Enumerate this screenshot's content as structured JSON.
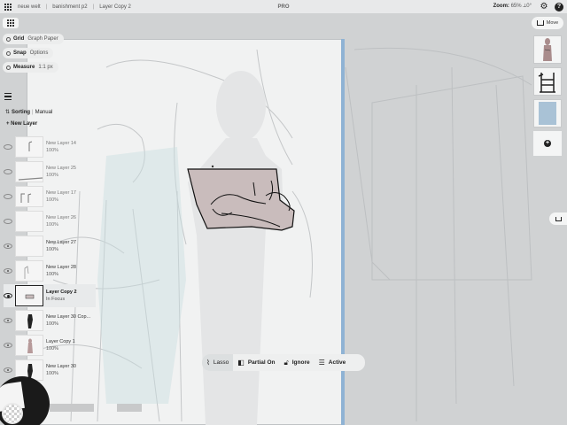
{
  "topbar": {
    "breadcrumbs": [
      "neue welt",
      "banishment p2",
      "Layer Copy 2"
    ],
    "title": "PRO",
    "zoom_label": "Zoom:",
    "zoom_value": "65% ⟂0°"
  },
  "tool_options": [
    {
      "label": "Grid",
      "value": "Graph Paper"
    },
    {
      "label": "Snap",
      "value": "Options"
    },
    {
      "label": "Measure",
      "value": "1:1 px"
    }
  ],
  "layers_panel": {
    "sorting_label": "Sorting",
    "sorting_value": "Manual",
    "new_layer_label": "+ New Layer",
    "layers": [
      {
        "name": "New Layer 14",
        "opacity": "100%"
      },
      {
        "name": "New Layer 25",
        "opacity": "100%"
      },
      {
        "name": "New Layer 17",
        "opacity": "100%"
      },
      {
        "name": "New Layer 26",
        "opacity": "100%"
      },
      {
        "name": "New Layer 27",
        "opacity": "100%"
      },
      {
        "name": "New Layer 28",
        "opacity": "100%"
      },
      {
        "name": "Layer Copy 2",
        "opacity": "In Focus"
      },
      {
        "name": "New Layer 30 Cop...",
        "opacity": "100%"
      },
      {
        "name": "Layer Copy 1",
        "opacity": "100%"
      },
      {
        "name": "New Layer 30",
        "opacity": "100%"
      }
    ]
  },
  "right_panel": {
    "move_label": "Move"
  },
  "selection_toolbar": {
    "lasso": "Lasso",
    "partial": "Partial On",
    "ignore": "Ignore",
    "active": "Active"
  },
  "colors": {
    "artwork_fill": "#c9bcbc",
    "accent_blue": "#8fb3d4"
  }
}
